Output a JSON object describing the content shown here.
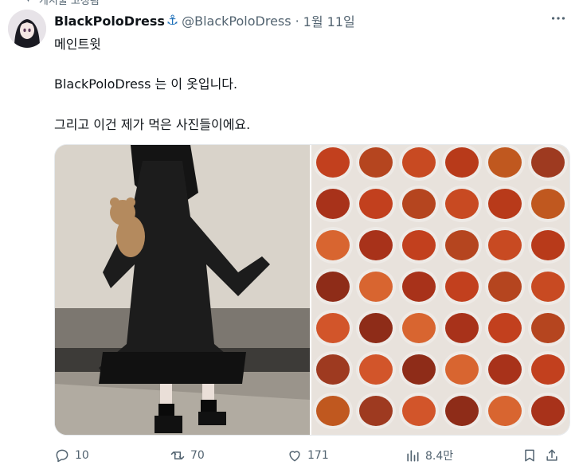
{
  "pinned": {
    "label": "게시물 고정됨"
  },
  "author": {
    "display_name": "BlackPoloDress",
    "handle": "@BlackPoloDress",
    "date": "1월 11일",
    "badge_icon": "anchor-icon"
  },
  "tweet": {
    "subtitle": "메인트윗",
    "line1": "BlackPoloDress 는 이 옷입니다.",
    "line2": "그리고 이건 제가 먹은 사진들이에요."
  },
  "actions": {
    "reply_count": "10",
    "retweet_count": "70",
    "like_count": "171",
    "views_count": "8.4만"
  },
  "colors": {
    "text": "#0f1419",
    "muted": "#536471",
    "badge": "#1d6fb8"
  }
}
